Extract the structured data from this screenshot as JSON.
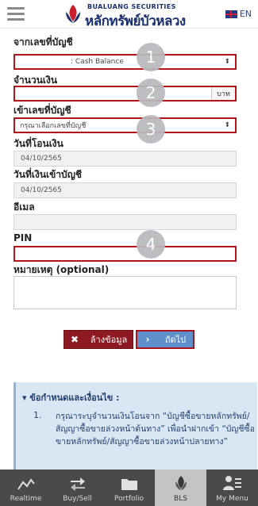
{
  "header": {
    "brand_small": "BUALUANG SECURITIES",
    "brand_big": "หลักทรัพย์บัวหลวง",
    "lang": "EN"
  },
  "form": {
    "from_account_label": "จากเลขที่บัญชี",
    "from_account_value": ": Cash Balance",
    "amount_label": "จำนวนเงิน",
    "amount_value": "",
    "amount_unit": "บาท",
    "to_account_label": "เข้าเลขที่บัญชี",
    "to_account_placeholder": "กรุณาเลือกเลขที่บัญชี",
    "transfer_date_label": "วันที่โอนเงิน",
    "transfer_date_value": "04/10/2565",
    "credit_date_label": "วันที่เงินเข้าบัญชี",
    "credit_date_value": "04/10/2565",
    "email_label": "อีเมล",
    "email_value": "",
    "pin_label": "PIN",
    "pin_value": "",
    "note_label": "หมายเหตุ (optional)",
    "note_value": ""
  },
  "badges": [
    "1",
    "2",
    "3",
    "4"
  ],
  "buttons": {
    "clear": "ล้างข้อมูล",
    "next": "ถัดไป"
  },
  "terms": {
    "heading": "ข้อกำหนดและเงื่อนไข :",
    "item_number": "1.",
    "item_text": "กรุณาระบุจำนวนเงินโอนจาก “บัญชีซื้อขายหลักทรัพย์/สัญญาซื้อขายล่วงหน้าต้นทาง” เพื่อนำฝากเข้า “บัญชีซื้อขายหลักทรัพย์/สัญญาซื้อขายล่วงหน้าปลายทาง”"
  },
  "tabs": [
    {
      "label": "Realtime",
      "icon": "chart-line-icon"
    },
    {
      "label": "Buy/Sell",
      "icon": "buy-sell-arrows-icon"
    },
    {
      "label": "Portfolio",
      "icon": "folder-icon"
    },
    {
      "label": "BLS",
      "icon": "bls-logo-icon",
      "active": true
    },
    {
      "label": "My Menu",
      "icon": "my-menu-icon"
    }
  ]
}
